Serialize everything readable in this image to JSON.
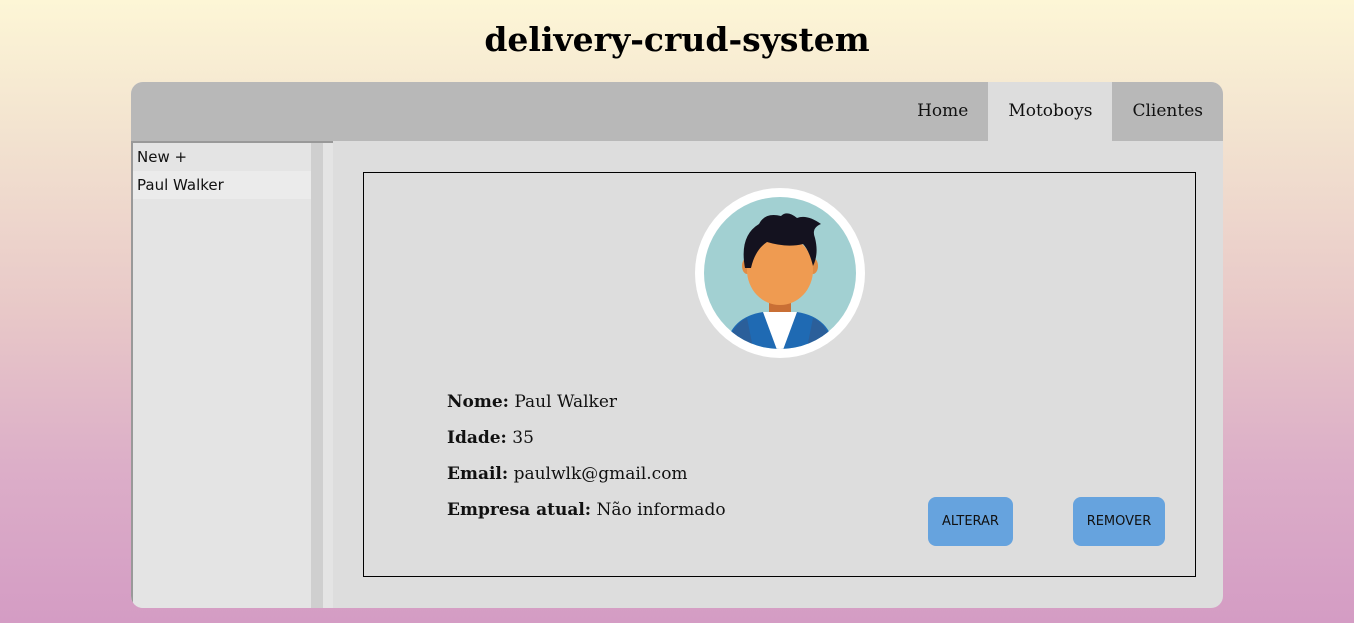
{
  "app": {
    "title": "delivery-crud-system"
  },
  "nav": {
    "items": [
      {
        "label": "Home"
      },
      {
        "label": "Motoboys"
      },
      {
        "label": "Clientes"
      }
    ],
    "active": "Motoboys"
  },
  "sidebar": {
    "items": [
      {
        "label": "New +"
      },
      {
        "label": "Paul Walker"
      }
    ]
  },
  "detail": {
    "avatar_icon": "person-avatar-icon",
    "fields": [
      {
        "label": "Nome:",
        "value": "Paul Walker"
      },
      {
        "label": "Idade:",
        "value": "35"
      },
      {
        "label": "Email:",
        "value": "paulwlk@gmail.com"
      },
      {
        "label": "Empresa atual:",
        "value": "Não informado"
      }
    ],
    "alterar_label": "ALTERAR",
    "remover_label": "REMOVER"
  },
  "colors": {
    "button": "#66a3de",
    "topbar": "#b8b8b8",
    "panel": "#dddddd"
  }
}
